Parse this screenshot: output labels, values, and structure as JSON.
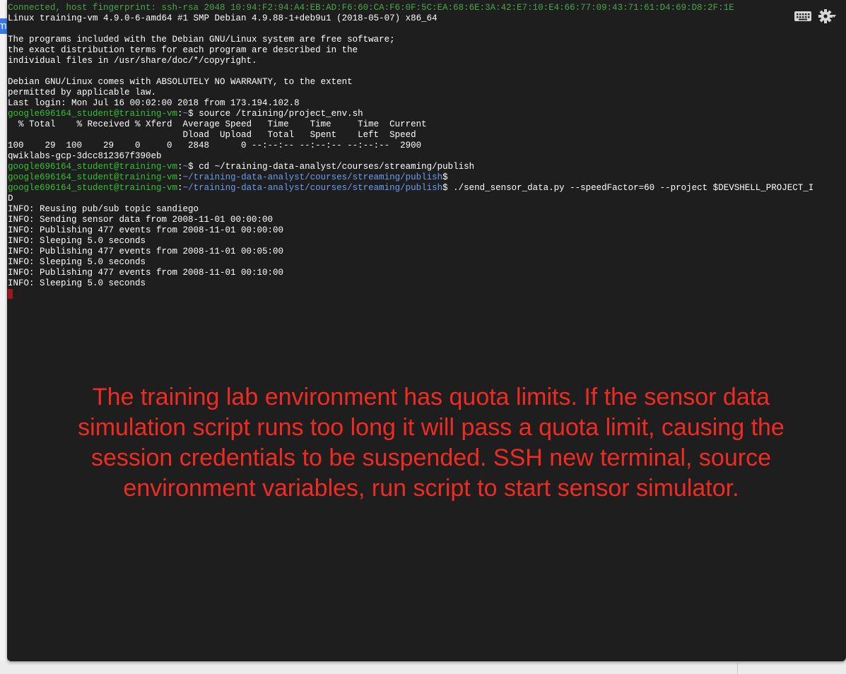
{
  "side_tab": {
    "label": "m"
  },
  "terminal": {
    "lines": [
      {
        "segments": [
          {
            "text": "Connected, host fingerprint: ssh-rsa 2048 10:94:F2:94:A4:EB:AD:F6:60:CA:F6:0F:5C:EA:68:6E:3A:42:E7:10:E4:66:77:09:43:71:61:D4:69:D8:2F:1E",
            "style": "conn"
          }
        ]
      },
      {
        "segments": [
          {
            "text": "Linux training-vm 4.9.0-6-amd64 #1 SMP Debian 4.9.88-1+deb9u1 (2018-05-07) x86_64",
            "style": ""
          }
        ]
      },
      {
        "segments": [
          {
            "text": "",
            "style": ""
          }
        ]
      },
      {
        "segments": [
          {
            "text": "The programs included with the Debian GNU/Linux system are free software;",
            "style": ""
          }
        ]
      },
      {
        "segments": [
          {
            "text": "the exact distribution terms for each program are described in the",
            "style": ""
          }
        ]
      },
      {
        "segments": [
          {
            "text": "individual files in /usr/share/doc/*/copyright.",
            "style": ""
          }
        ]
      },
      {
        "segments": [
          {
            "text": "",
            "style": ""
          }
        ]
      },
      {
        "segments": [
          {
            "text": "Debian GNU/Linux comes with ABSOLUTELY NO WARRANTY, to the extent",
            "style": ""
          }
        ]
      },
      {
        "segments": [
          {
            "text": "permitted by applicable law.",
            "style": ""
          }
        ]
      },
      {
        "segments": [
          {
            "text": "Last login: Mon Jul 16 00:02:00 2018 from 173.194.102.8",
            "style": ""
          }
        ]
      },
      {
        "segments": [
          {
            "text": "google696164_student@training-vm",
            "style": "green"
          },
          {
            "text": ":",
            "style": ""
          },
          {
            "text": "~",
            "style": "blue"
          },
          {
            "text": "$ source /training/project_env.sh",
            "style": ""
          }
        ]
      },
      {
        "segments": [
          {
            "text": "  % Total    % Received % Xferd  Average Speed   Time    Time     Time  Current",
            "style": ""
          }
        ]
      },
      {
        "segments": [
          {
            "text": "                                 Dload  Upload   Total   Spent    Left  Speed",
            "style": ""
          }
        ]
      },
      {
        "segments": [
          {
            "text": "100    29  100    29    0     0   2848      0 --:--:-- --:--:-- --:--:--  2900",
            "style": ""
          }
        ]
      },
      {
        "segments": [
          {
            "text": "qwiklabs-gcp-3dcc812367f390eb",
            "style": ""
          }
        ]
      },
      {
        "segments": [
          {
            "text": "google696164_student@training-vm",
            "style": "green"
          },
          {
            "text": ":",
            "style": ""
          },
          {
            "text": "~",
            "style": "blue"
          },
          {
            "text": "$ cd ~/training-data-analyst/courses/streaming/publish",
            "style": ""
          }
        ]
      },
      {
        "segments": [
          {
            "text": "google696164_student@training-vm",
            "style": "green"
          },
          {
            "text": ":",
            "style": ""
          },
          {
            "text": "~/training-data-analyst/courses/streaming/publish",
            "style": "blue"
          },
          {
            "text": "$",
            "style": ""
          }
        ]
      },
      {
        "segments": [
          {
            "text": "google696164_student@training-vm",
            "style": "green"
          },
          {
            "text": ":",
            "style": ""
          },
          {
            "text": "~/training-data-analyst/courses/streaming/publish",
            "style": "blue"
          },
          {
            "text": "$ ./send_sensor_data.py --speedFactor=60 --project $DEVSHELL_PROJECT_I",
            "style": ""
          }
        ]
      },
      {
        "segments": [
          {
            "text": "D",
            "style": ""
          }
        ]
      },
      {
        "segments": [
          {
            "text": "INFO: Reusing pub/sub topic sandiego",
            "style": ""
          }
        ]
      },
      {
        "segments": [
          {
            "text": "INFO: Sending sensor data from 2008-11-01 00:00:00",
            "style": ""
          }
        ]
      },
      {
        "segments": [
          {
            "text": "INFO: Publishing 477 events from 2008-11-01 00:00:00",
            "style": ""
          }
        ]
      },
      {
        "segments": [
          {
            "text": "INFO: Sleeping 5.0 seconds",
            "style": ""
          }
        ]
      },
      {
        "segments": [
          {
            "text": "INFO: Publishing 477 events from 2008-11-01 00:05:00",
            "style": ""
          }
        ]
      },
      {
        "segments": [
          {
            "text": "INFO: Sleeping 5.0 seconds",
            "style": ""
          }
        ]
      },
      {
        "segments": [
          {
            "text": "INFO: Publishing 477 events from 2008-11-01 00:10:00",
            "style": ""
          }
        ]
      },
      {
        "segments": [
          {
            "text": "INFO: Sleeping 5.0 seconds",
            "style": ""
          }
        ]
      }
    ],
    "cursor_color": "#a1141c",
    "icons": {
      "keyboard": "keyboard-icon",
      "settings": "gear-icon"
    }
  },
  "annotation": {
    "text": "The training lab environment has quota limits. If the sensor data\nsimulation script runs too long it will pass a quota limit, causing the\nsession credentials to be suspended.  SSH new terminal, source\nenvironment variables, run script to start sensor simulator.",
    "color": "#f02b22"
  },
  "colors": {
    "terminal_bg": "#1e1e1e",
    "prompt_user": "#32c232",
    "prompt_path": "#6b9df2",
    "connected_text": "#4aa74a"
  }
}
